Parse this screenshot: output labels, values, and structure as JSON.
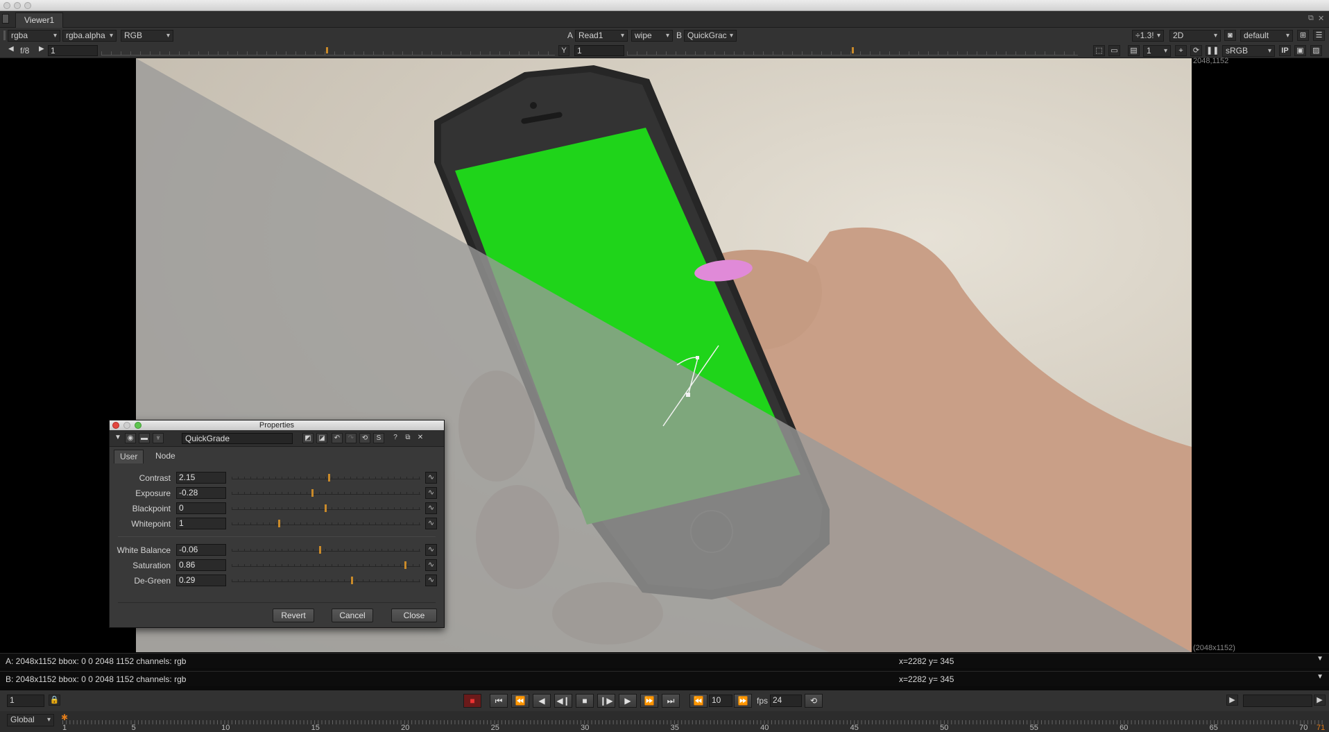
{
  "window": {
    "tab_label": "Viewer1"
  },
  "toolbar1": {
    "channels": "rgba",
    "alpha": "rgba.alpha",
    "display_channels": "RGB",
    "input_a_label": "A",
    "input_a": "Read1",
    "compare_mode": "wipe",
    "input_b_label": "B",
    "input_b": "QuickGrac",
    "zoom": "÷1.3!",
    "view_mode": "2D",
    "lut_set": "default"
  },
  "toolbar2": {
    "fstop": "f/8",
    "gain_value": "1",
    "gamma_label": "Y",
    "gamma_value": "1",
    "proxy": "1",
    "colorspace": "sRGB",
    "ip_label": "IP"
  },
  "viewer": {
    "format_top_right": "2048,1152",
    "format_bottom_right": "(2048x1152)"
  },
  "properties": {
    "title": "Properties",
    "node_name": "QuickGrade",
    "tabs": [
      "User",
      "Node"
    ],
    "params": [
      {
        "label": "Contrast",
        "value": "2.15",
        "pos": 0.52
      },
      {
        "label": "Exposure",
        "value": "-0.28",
        "pos": 0.43
      },
      {
        "label": "Blackpoint",
        "value": "0",
        "pos": 0.5
      },
      {
        "label": "Whitepoint",
        "value": "1",
        "pos": 0.25
      }
    ],
    "params2": [
      {
        "label": "White Balance",
        "value": "-0.06",
        "pos": 0.47
      },
      {
        "label": "Saturation",
        "value": "0.86",
        "pos": 0.93
      },
      {
        "label": "De-Green",
        "value": "0.29",
        "pos": 0.64
      }
    ],
    "buttons": {
      "revert": "Revert",
      "cancel": "Cancel",
      "close": "Close"
    }
  },
  "info": {
    "a_text": "A:  2048x1152 bbox: 0 0 2048 1152 channels: rgb",
    "a_coords": "x=2282 y= 345",
    "b_text": "B:  2048x1152 bbox: 0 0 2048 1152 channels: rgb",
    "b_coords": "x=2282 y= 345"
  },
  "playback": {
    "frame": "1",
    "increment": "10",
    "fps_label": "fps",
    "fps": "24"
  },
  "timeline": {
    "scope": "Global",
    "start": "1",
    "end": "71",
    "ticks": [
      "5",
      "10",
      "15",
      "20",
      "25",
      "30",
      "35",
      "40",
      "45",
      "50",
      "55",
      "60",
      "65",
      "70"
    ]
  }
}
